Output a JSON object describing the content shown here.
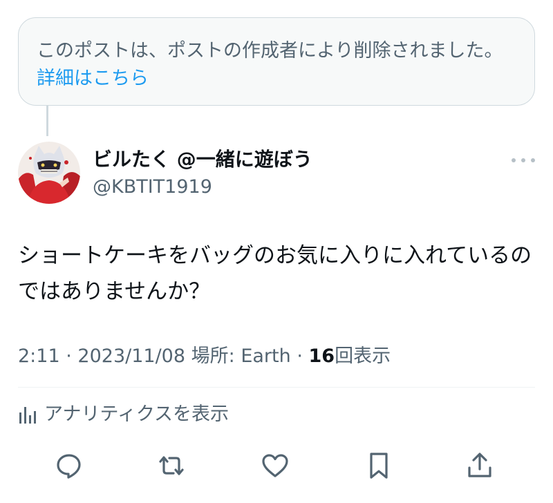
{
  "deleted_notice": {
    "text": "このポストは、ポストの作成者により削除されました。",
    "link": "詳細はこちら"
  },
  "author": {
    "name": "ビルたく @一緒に遊ぼう",
    "handle": "@KBTIT1919"
  },
  "post": {
    "text": "ショートケーキをバッグのお気に入りに入れているのではありませんか？"
  },
  "meta": {
    "time": "2:11",
    "date": "2023/11/08",
    "location": "場所: Earth",
    "separator": "·",
    "views_count": "16",
    "views_label": "回表示"
  },
  "analytics": {
    "label": "アナリティクスを表示"
  },
  "actions": {
    "icon_color": "#536471",
    "icons": [
      "reply-icon",
      "repost-icon",
      "like-icon",
      "bookmark-icon",
      "share-icon"
    ]
  },
  "colors": {
    "link": "#1d9bf0",
    "secondary_text": "#536471",
    "primary_text": "#0f1419",
    "notice_bg": "#f7f9f9",
    "border": "#cfd9de"
  }
}
